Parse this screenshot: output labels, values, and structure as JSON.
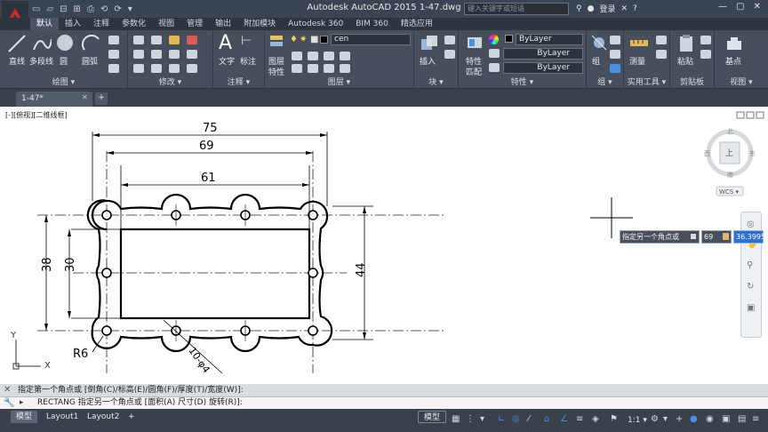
{
  "app": {
    "title": "Autodesk AutoCAD 2015    1-47.dwg"
  },
  "qat": {
    "items": [
      "▭",
      "▱",
      "⊟",
      "⊞",
      "⎙",
      "⟲",
      "⟳",
      "▾"
    ]
  },
  "search": {
    "placeholder": "键入关键字或短语"
  },
  "user": {
    "login_label": "登录"
  },
  "ribbon_tabs": [
    "默认",
    "插入",
    "注释",
    "参数化",
    "视图",
    "管理",
    "输出",
    "附加模块",
    "Autodesk 360",
    "BIM 360",
    "精选应用"
  ],
  "ribbon": {
    "draw": {
      "title": "绘图 ▾",
      "line": "直线",
      "polyline": "多段线",
      "circle": "圆",
      "arc": "圆弧"
    },
    "modify": {
      "title": "修改 ▾"
    },
    "annotation": {
      "title": "注释 ▾",
      "text": "文字",
      "dimension": "标注"
    },
    "layers": {
      "title": "图层 ▾",
      "layer_props_1": "图层",
      "layer_props_2": "特性",
      "current_layer": "cen"
    },
    "block": {
      "title": "块 ▾",
      "insert": "插入"
    },
    "properties": {
      "title": "特性 ▾",
      "match_1": "特性",
      "match_2": "匹配",
      "color": "ByLayer",
      "linetype": "ByLayer",
      "lineweight": "ByLayer"
    },
    "groups": {
      "title": "组 ▾",
      "group": "组"
    },
    "utilities": {
      "title": "实用工具 ▾",
      "measure": "测量"
    },
    "clipboard": {
      "title": "剪贴板",
      "paste": "粘贴"
    },
    "view": {
      "title": "视图 ▾",
      "base": "基点"
    }
  },
  "document": {
    "tab_label": "1-47*",
    "new_tab": "+"
  },
  "viewport": {
    "label": "[-][俯视][二维线框]"
  },
  "viewcube": {
    "north": "北",
    "south": "南",
    "east": "东",
    "west": "西",
    "top": "上",
    "wcs": "WCS ▾"
  },
  "drawing": {
    "dims": [
      "75",
      "69",
      "61",
      "38",
      "30",
      "44"
    ],
    "radius_label": "R6",
    "holes_label": "10-φ4",
    "axis_x": "X",
    "axis_y": "Y"
  },
  "dynamic_input": {
    "prompt": "指定另一个角点或",
    "value1": "69",
    "value2": "36.3995"
  },
  "command": {
    "history": "指定第一个角点或 [倒角(C)/标高(E)/圆角(F)/厚度(T)/宽度(W)]:",
    "current": "RECTANG 指定另一个角点或 [面积(A) 尺寸(D) 旋转(R)]:"
  },
  "status": {
    "layout_tabs": [
      "模型",
      "Layout1",
      "Layout2"
    ],
    "model_label": "模型",
    "scale": "1:1 ▾"
  },
  "colors": {
    "titlebar": "#3b4453",
    "ribbon": "#474f5d",
    "accent": "#2e6fd0",
    "app_logo": "#d1262c"
  }
}
